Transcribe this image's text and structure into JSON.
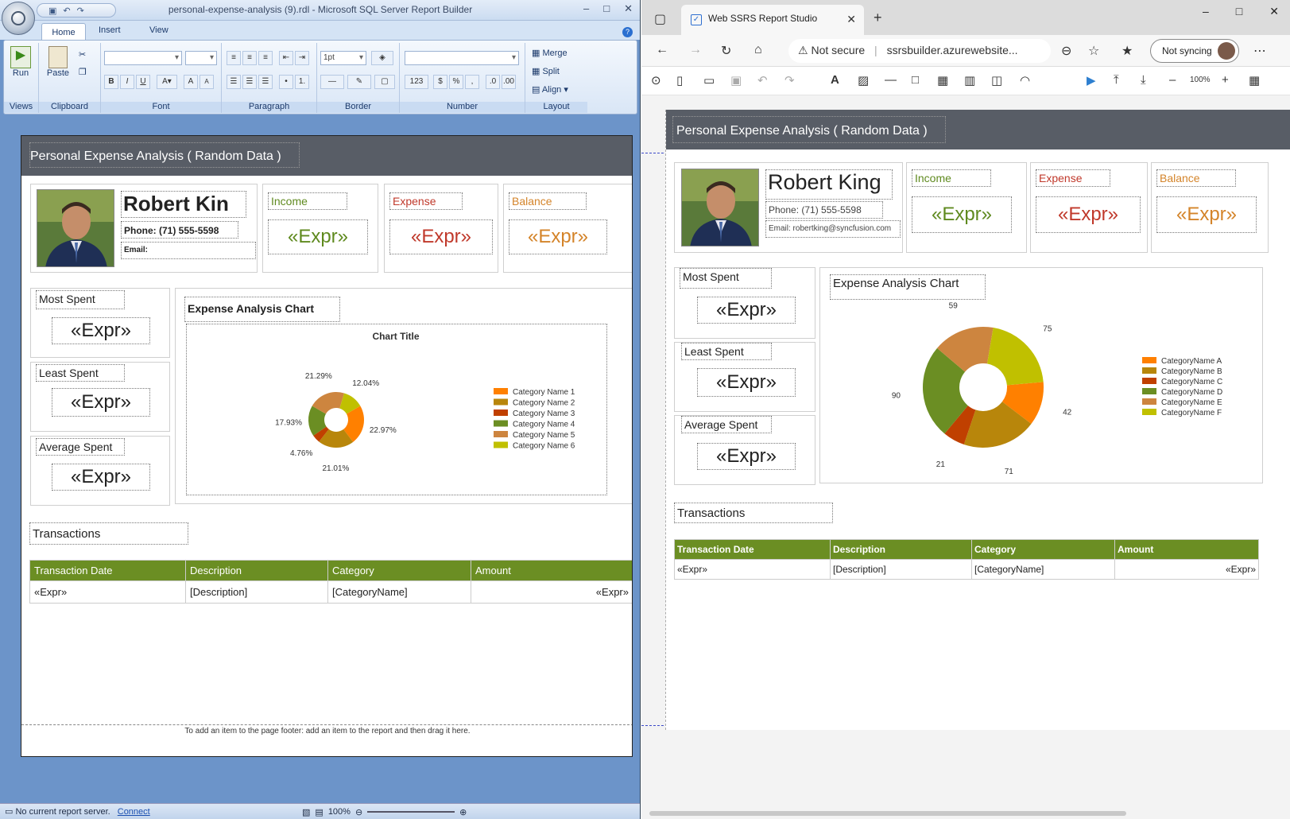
{
  "left": {
    "window_title": "personal-expense-analysis (9).rdl - Microsoft SQL Server Report Builder",
    "tabs": [
      "Home",
      "Insert",
      "View"
    ],
    "ribbon": {
      "run": "Run",
      "paste": "Paste",
      "font_size": "1pt",
      "merge": "Merge",
      "split": "Split",
      "align": "Align",
      "groups": [
        "Views",
        "Clipboard",
        "Font",
        "Paragraph",
        "Border",
        "Number",
        "Layout"
      ]
    },
    "report": {
      "title": "Personal Expense Analysis ( Random Data )",
      "name": "Robert Kin",
      "phone": "Phone: (71) 555-5598",
      "email": "Email:",
      "income_label": "Income",
      "expense_label": "Expense",
      "balance_label": "Balance",
      "expr": "«Expr»",
      "most_spent": "Most Spent",
      "least_spent": "Least Spent",
      "average_spent": "Average Spent",
      "chart_heading": "Expense Analysis Chart",
      "chart_title": "Chart Title",
      "transactions": "Transactions",
      "columns": [
        "Transaction Date",
        "Description",
        "Category",
        "Amount"
      ],
      "row": [
        "«Expr»",
        "[Description]",
        "[CategoryName]",
        "«Expr»"
      ],
      "footer_hint": "To add an item to the page footer: add an item to the report and then drag it here."
    },
    "status": {
      "text": "No current report server.",
      "link": "Connect",
      "zoom": "100%"
    }
  },
  "right": {
    "tab_title": "Web SSRS Report Studio",
    "not_secure": "Not secure",
    "url": "ssrsbuilder.azurewebsite...",
    "not_syncing": "Not syncing",
    "zoom": "100%",
    "report": {
      "title": "Personal Expense Analysis ( Random Data )",
      "name": "Robert King",
      "phone": "Phone: (71) 555-5598",
      "email": "Email: robertking@syncfusion.com",
      "income_label": "Income",
      "expense_label": "Expense",
      "balance_label": "Balance",
      "expr": "«Expr»",
      "most_spent": "Most Spent",
      "least_spent": "Least Spent",
      "average_spent": "Average Spent",
      "chart_heading": "Expense Analysis Chart",
      "transactions": "Transactions",
      "columns": [
        "Transaction Date",
        "Description",
        "Category",
        "Amount"
      ],
      "row": [
        "«Expr»",
        "[Description]",
        "[CategoryName]",
        "«Expr»"
      ]
    }
  },
  "colors": {
    "header": "#585d66",
    "table_header": "#6b8e23",
    "income": "#5f8a1f",
    "expense": "#c0392b",
    "balance": "#d4842a"
  },
  "chart_data": [
    {
      "type": "pie",
      "title": "Chart Title",
      "categories": [
        "Category Name 1",
        "Category Name 2",
        "Category Name 3",
        "Category Name 4",
        "Category Name 5",
        "Category Name 6"
      ],
      "values": [
        22.97,
        21.01,
        4.76,
        17.93,
        21.29,
        12.04
      ],
      "labels": [
        "22.97%",
        "21.01%",
        "4.76%",
        "17.93%",
        "21.29%",
        "12.04%"
      ],
      "colors": [
        "#ff8000",
        "#b8860b",
        "#c04000",
        "#6b8e23",
        "#cd853f",
        "#c0c000"
      ],
      "legend": "right"
    },
    {
      "type": "pie",
      "title": "",
      "categories": [
        "CategoryName A",
        "CategoryName B",
        "CategoryName C",
        "CategoryName D",
        "CategoryName E",
        "CategoryName F"
      ],
      "values": [
        42,
        71,
        21,
        90,
        59,
        75
      ],
      "labels": [
        "42",
        "71",
        "21",
        "90",
        "59",
        "75"
      ],
      "colors": [
        "#ff8000",
        "#b8860b",
        "#c04000",
        "#6b8e23",
        "#cd853f",
        "#c0c000"
      ],
      "legend": "right"
    }
  ]
}
